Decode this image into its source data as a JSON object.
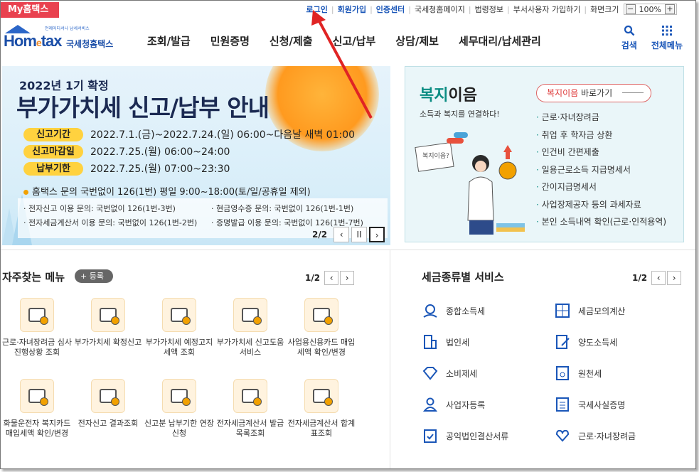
{
  "topbar": {
    "my_hometax": "My홈택스",
    "links": [
      "로그인",
      "회원가입",
      "인증센터",
      "국세청홈페이지",
      "법령정보",
      "부서사용자 가입하기",
      "화면크기"
    ],
    "zoom_minus": "−",
    "zoom_value": "100%",
    "zoom_plus": "+"
  },
  "logo": {
    "small": "언제어디서나 납세서비스",
    "main_a": "Hom",
    "main_e": "e",
    "main_b": "tax",
    "kr": "국세청홈택스"
  },
  "gnb": [
    "조회/발급",
    "민원증명",
    "신청/제출",
    "신고/납부",
    "상담/제보",
    "세무대리/납세관리"
  ],
  "right_icons": {
    "search": "검색",
    "allmenu": "전체메뉴"
  },
  "banner": {
    "sub": "2022년 1기 확정",
    "title": "부가가치세 신고/납부 안내",
    "schedule": [
      {
        "tag": "신고기간",
        "value": "2022.7.1.(금)~2022.7.24.(일) 06:00~다음날 새벽 01:00"
      },
      {
        "tag": "신고마감일",
        "value": "2022.7.25.(월) 06:00~24:00"
      },
      {
        "tag": "납부기한",
        "value": "2022.7.25.(월) 07:00~23:30"
      }
    ],
    "inquiry": "홈택스 문의 국번없이 126(1번)   평일 9:00~18:00(토/일/공휴일 제외)",
    "inq_lines": [
      "· 전자신고 이용 문의: 국번없이 126(1번-3번)",
      "· 현금영수증 문의: 국번없이 126(1번-1번)",
      "· 전자세금계산서 이용 문의: 국번없이 126(1번-2번)",
      "· 증명발급 이용 문의: 국번없이 126(1번-7번)"
    ],
    "pager": "2/2",
    "prev": "‹",
    "pause": "II",
    "next": "›"
  },
  "welfare": {
    "title_a": "복지",
    "title_b": "이음",
    "sub": "소득과 복지를 연결하다!",
    "button_a": "복지이음",
    "button_b": " 바로가기",
    "items": [
      "근로·자녀장려금",
      "취업 후 학자금 상환",
      "인건비 간편제출",
      "일용근로소득 지급명세서",
      "간이지급명세서",
      "사업장제공자 등의 과세자료",
      "본인 소득내역 확인(근로·인적용역)"
    ],
    "sign_text": "복지이음?"
  },
  "favorites": {
    "title": "자주찾는 메뉴",
    "register": "+ 등록",
    "page": "1/2",
    "prev": "‹",
    "next": "›",
    "items": [
      {
        "label": "근로·자녀장려금 심사진행상황 조회"
      },
      {
        "label": "부가가치세 확정신고"
      },
      {
        "label": "부가가치세 예정고지세액 조회"
      },
      {
        "label": "부가가치세 신고도움 서비스"
      },
      {
        "label": "사업용신용카드 매입세액 확인/변경"
      },
      {
        "label": "화물운전자 복지카드 매입세액 확인/변경"
      },
      {
        "label": "전자신고 결과조회"
      },
      {
        "label": "신고분 납부기한 연장신청"
      },
      {
        "label": "전자세금계산서 발급목록조회"
      },
      {
        "label": "전자세금계산서 합계표조회"
      }
    ]
  },
  "services": {
    "title": "세금종류별 서비스",
    "page": "1/2",
    "prev": "‹",
    "next": "›",
    "items": [
      "종합소득세",
      "세금모의계산",
      "법인세",
      "양도소득세",
      "소비제세",
      "원천세",
      "사업자등록",
      "국세사실증명",
      "공익법인결산서류",
      "근로·자녀장려금"
    ]
  },
  "colors": {
    "accent": "#1a56b8",
    "my_hometax": "#e9414f",
    "annotation_arrow": "#e02424",
    "welfare_green": "#0c8d83",
    "tag_yellow": "#ffd23f"
  }
}
